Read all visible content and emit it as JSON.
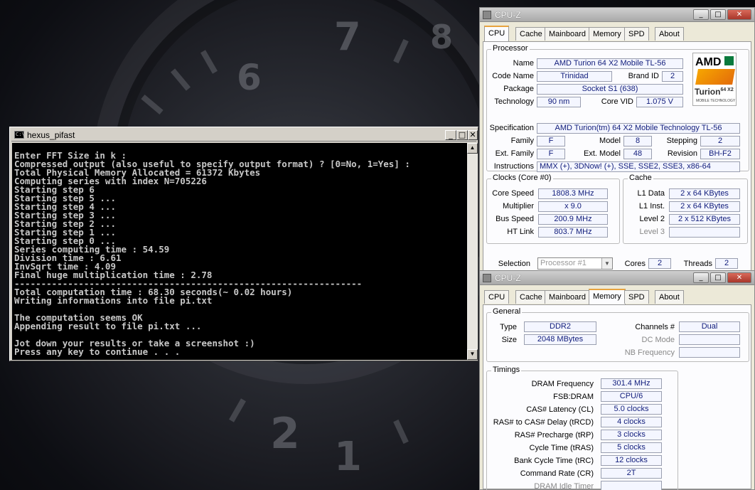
{
  "desktop": {
    "clock_numerals": [
      "7",
      "8",
      "6",
      "2",
      "1"
    ]
  },
  "console": {
    "title": "hexus_pifast",
    "icon_text": "C:\\",
    "lines": [
      "Enter FFT Size in k :",
      "Compressed output (also useful to specify output format) ? [0=No, 1=Yes] :",
      "Total Physical Memory Allocated = 61372 Kbytes",
      "Computing series with index N=705226",
      "Starting step 6",
      "Starting step 5 ...",
      "Starting step 4 ...",
      "Starting step 3 ...",
      "Starting step 2 ...",
      "Starting step 1 ...",
      "Starting step 0 ...",
      "Series computing time : 54.59",
      "Division time : 6.61",
      "InvSqrt time : 4.09",
      "Final huge multiplication time : 2.78",
      "-----------------------------------------------------------------",
      "Total computation time : 68.30 seconds(~ 0.02 hours)",
      "Writing informations into file pi.txt",
      "",
      "The computation seems OK",
      "Appending result to file pi.txt ...",
      "",
      "Jot down your results or take a screenshot :)",
      "Press any key to continue . . ."
    ]
  },
  "cpuz_cpu": {
    "title": "CPU-Z",
    "tabs": [
      "CPU",
      "Cache",
      "Mainboard",
      "Memory",
      "SPD",
      "About"
    ],
    "processor": {
      "group": "Processor",
      "name_label": "Name",
      "name": "AMD Turion 64 X2 Mobile TL-56",
      "codename_label": "Code Name",
      "codename": "Trinidad",
      "brandid_label": "Brand ID",
      "brandid": "2",
      "package_label": "Package",
      "package": "Socket S1 (638)",
      "technology_label": "Technology",
      "technology": "90 nm",
      "corevid_label": "Core VID",
      "corevid": "1.075 V",
      "spec_label": "Specification",
      "spec": "AMD Turion(tm) 64 X2 Mobile Technology TL-56",
      "family_label": "Family",
      "family": "F",
      "model_label": "Model",
      "model": "8",
      "stepping_label": "Stepping",
      "stepping": "2",
      "extfamily_label": "Ext. Family",
      "extfamily": "F",
      "extmodel_label": "Ext. Model",
      "extmodel": "48",
      "revision_label": "Revision",
      "revision": "BH-F2",
      "instr_label": "Instructions",
      "instr": "MMX (+), 3DNow! (+), SSE, SSE2, SSE3, x86-64"
    },
    "logo": {
      "brand": "AMD",
      "product": "Turion",
      "product_suffix": "64 X2",
      "tagline": "MOBILE TECHNOLOGY"
    },
    "clocks": {
      "group": "Clocks (Core #0)",
      "corespeed_label": "Core Speed",
      "corespeed": "1808.3 MHz",
      "mult_label": "Multiplier",
      "mult": "x 9.0",
      "bus_label": "Bus Speed",
      "bus": "200.9 MHz",
      "ht_label": "HT Link",
      "ht": "803.7 MHz"
    },
    "cache": {
      "group": "Cache",
      "l1d_label": "L1 Data",
      "l1d": "2 x 64 KBytes",
      "l1i_label": "L1 Inst.",
      "l1i": "2 x 64 KBytes",
      "l2_label": "Level 2",
      "l2": "2 x 512 KBytes",
      "l3_label": "Level 3",
      "l3": ""
    },
    "selection": {
      "label": "Selection",
      "value": "Processor #1",
      "cores_label": "Cores",
      "cores": "2",
      "threads_label": "Threads",
      "threads": "2"
    }
  },
  "cpuz_mem": {
    "title": "CPU-Z",
    "tabs": [
      "CPU",
      "Cache",
      "Mainboard",
      "Memory",
      "SPD",
      "About"
    ],
    "general": {
      "group": "General",
      "type_label": "Type",
      "type": "DDR2",
      "size_label": "Size",
      "size": "2048 MBytes",
      "channels_label": "Channels #",
      "channels": "Dual",
      "dcmode_label": "DC Mode",
      "dcmode": "",
      "nbfreq_label": "NB Frequency",
      "nbfreq": ""
    },
    "timings": {
      "group": "Timings",
      "dram_label": "DRAM Frequency",
      "dram": "301.4 MHz",
      "fsb_label": "FSB:DRAM",
      "fsb": "CPU/6",
      "cas_label": "CAS# Latency (CL)",
      "cas": "5.0 clocks",
      "rcd_label": "RAS# to CAS# Delay (tRCD)",
      "rcd": "4 clocks",
      "rp_label": "RAS# Precharge (tRP)",
      "rp": "3 clocks",
      "ras_label": "Cycle Time (tRAS)",
      "ras": "5 clocks",
      "rc_label": "Bank Cycle Time (tRC)",
      "rc": "12 clocks",
      "cr_label": "Command Rate (CR)",
      "cr": "2T",
      "idle_label": "DRAM Idle Timer",
      "idle": ""
    }
  }
}
